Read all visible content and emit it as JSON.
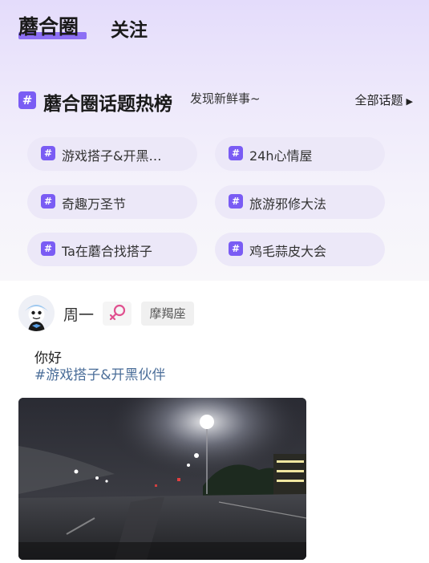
{
  "tabs": {
    "active": "蘑合圈",
    "follow": "关注"
  },
  "topics_section": {
    "hash_symbol": "#",
    "title": "蘑合圈话题热榜",
    "subtitle": "发现新鲜事~",
    "all_label": "全部话题",
    "all_arrow": "▶"
  },
  "topics": [
    {
      "label": "游戏搭子&开黑…"
    },
    {
      "label": "24h心情屋"
    },
    {
      "label": "奇趣万圣节"
    },
    {
      "label": "旅游邪修大法"
    },
    {
      "label": "Ta在蘑合找搭子"
    },
    {
      "label": "鸡毛蒜皮大会"
    }
  ],
  "post": {
    "author": "周一",
    "gender_icon": "female-icon",
    "zodiac": "摩羯座",
    "text": "你好",
    "tag": "#游戏搭子&开黑伙伴"
  },
  "colors": {
    "accent": "#7a5cf4",
    "female": "#e0508f",
    "tag_link": "#4b6e99"
  }
}
